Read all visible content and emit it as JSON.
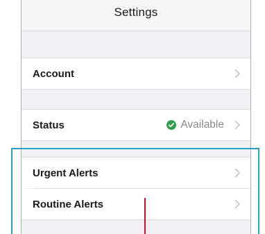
{
  "nav": {
    "title": "Settings"
  },
  "rows": {
    "account": {
      "label": "Account"
    },
    "status": {
      "label": "Status",
      "value": "Available",
      "value_color": "#2e9e4a"
    },
    "urgent_alerts": {
      "label": "Urgent Alerts"
    },
    "routine_alerts": {
      "label": "Routine Alerts"
    }
  },
  "icons": {
    "chevron": "chevron-right-icon",
    "status": "check-circle-icon"
  },
  "colors": {
    "highlight": "#2a9fc9",
    "marker": "#c8102e",
    "background": "#f0f0f4"
  }
}
